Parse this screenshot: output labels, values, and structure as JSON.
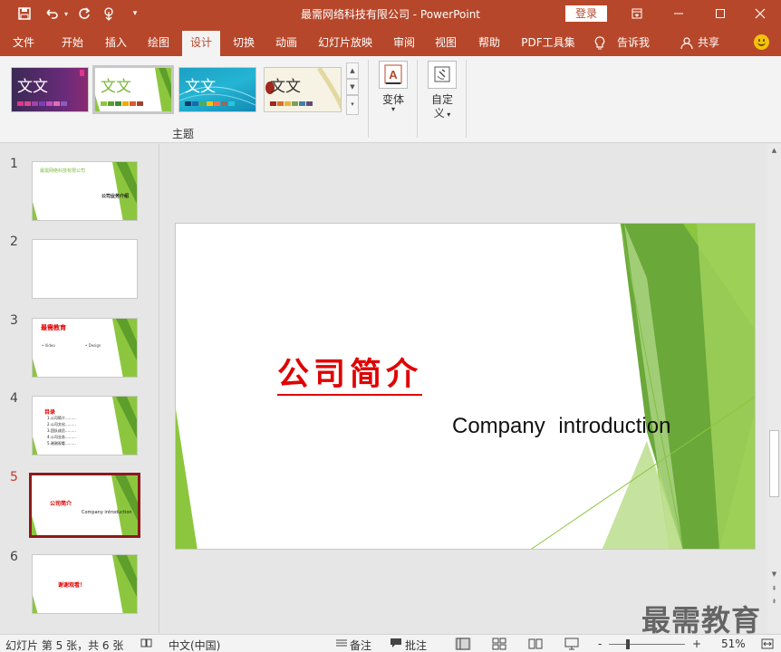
{
  "titlebar": {
    "title": "最需网络科技有限公司  -  PowerPoint",
    "login_label": "登录",
    "quick_access": [
      "save-icon",
      "undo-icon",
      "redo-icon",
      "touch-mode-icon",
      "customize-icon"
    ]
  },
  "tabs": [
    {
      "label": "文件"
    },
    {
      "label": "开始"
    },
    {
      "label": "插入"
    },
    {
      "label": "绘图"
    },
    {
      "label": "设计",
      "active": true
    },
    {
      "label": "切换"
    },
    {
      "label": "动画"
    },
    {
      "label": "幻灯片放映"
    },
    {
      "label": "审阅"
    },
    {
      "label": "视图"
    },
    {
      "label": "帮助"
    },
    {
      "label": "PDF工具集"
    },
    {
      "label": "告诉我"
    },
    {
      "label": "共享"
    }
  ],
  "ribbon": {
    "themes": [
      {
        "sample": "文文"
      },
      {
        "sample": "文文",
        "selected": true
      },
      {
        "sample": "文文"
      },
      {
        "sample": "文文"
      }
    ],
    "themes_group_label": "主题",
    "variants_label": "变体",
    "customize_label_1": "自定",
    "customize_label_2": "义"
  },
  "slides": [
    {
      "number": "1",
      "text_1": "最需网络科技有限公司",
      "text_2": "公司业务介绍"
    },
    {
      "number": "2"
    },
    {
      "number": "3",
      "text_1": "最需教育",
      "text_2": "• Video",
      "text_3": "• Design"
    },
    {
      "number": "4",
      "text_1": "目录",
      "lines": [
        "1.公司简介………",
        "2.公司文化………",
        "3.团队成员………",
        "4.公司业务………",
        "5.谢谢观看………"
      ]
    },
    {
      "number": "5",
      "active": true,
      "text_1": "公司简介",
      "text_2": "Company  introduction"
    },
    {
      "number": "6",
      "text_1": "谢谢观看！"
    }
  ],
  "current_slide": {
    "title": "公司简介",
    "subtitle": "Company  introduction",
    "title_color": "#e00000"
  },
  "watermark": "最需教育",
  "statusbar": {
    "slide_info": "幻灯片 第 5 张，共 6 张",
    "language": "中文(中国)",
    "notes_label": "备注",
    "comments_label": "批注",
    "zoom": "51%",
    "zoom_out": "-",
    "zoom_in": "+"
  },
  "colors": {
    "accent": "#b7472a",
    "green_light": "#a8d46a",
    "green_dark": "#5e9e2a",
    "active_thumb_border": "#8b1a1a"
  }
}
